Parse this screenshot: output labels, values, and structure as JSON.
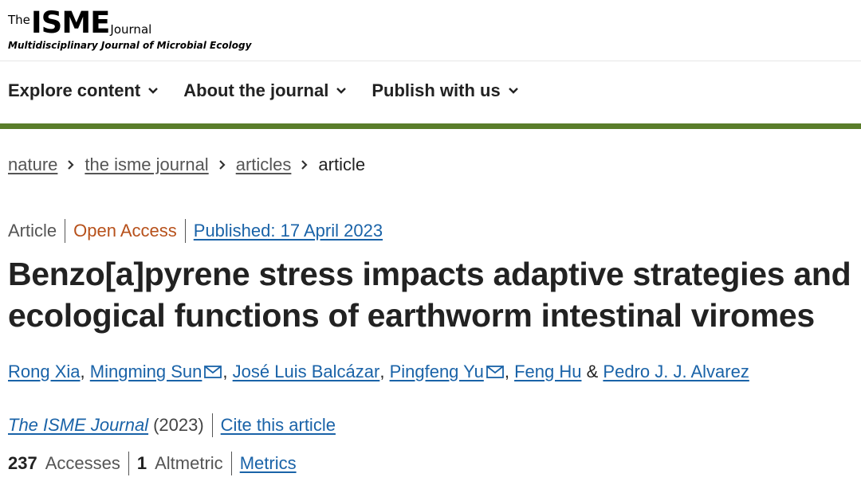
{
  "logo": {
    "the": "The",
    "isme": "ISME",
    "journal": "Journal",
    "subtitle": "Multidisciplinary Journal of Microbial Ecology"
  },
  "nav": {
    "items": [
      {
        "label": "Explore content",
        "icon": "chevron-down-icon"
      },
      {
        "label": "About the journal",
        "icon": "chevron-down-icon"
      },
      {
        "label": "Publish with us",
        "icon": "chevron-down-icon"
      }
    ]
  },
  "colors": {
    "accent_bar": "#5a7d2a",
    "link": "#1a63a8",
    "open_access": "#b7511b"
  },
  "breadcrumb": {
    "items": [
      "nature",
      "the isme journal",
      "articles"
    ],
    "current": "article"
  },
  "article": {
    "type": "Article",
    "access": "Open Access",
    "published": "Published: 17 April 2023",
    "title_line1": "Benzo[a]pyrene stress impacts adaptive strategies and",
    "title_line2": "ecological functions of earthworm intestinal viromes",
    "authors": [
      {
        "name": "Rong Xia",
        "mail": false
      },
      {
        "name": "Mingming Sun",
        "mail": true
      },
      {
        "name": "José Luis Balcázar",
        "mail": false
      },
      {
        "name": "Pingfeng Yu",
        "mail": true
      },
      {
        "name": "Feng Hu",
        "mail": false
      },
      {
        "name": "Pedro J. J. Alvarez",
        "mail": false
      }
    ],
    "comma": ",",
    "ampersand": "&",
    "journal": "The ISME Journal",
    "year": "(2023)",
    "cite_label": "Cite this article",
    "accesses_count": "237",
    "accesses_label": "Accesses",
    "altmetric_count": "1",
    "altmetric_label": "Altmetric",
    "metrics_label": "Metrics"
  }
}
